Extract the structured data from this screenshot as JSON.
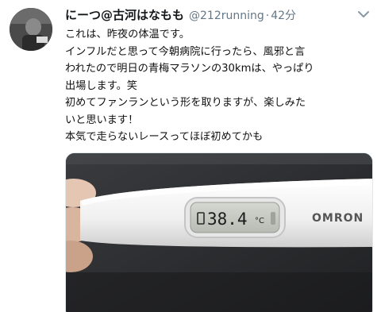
{
  "user": {
    "display_name": "にーつ@古河はなもも",
    "handle": "@212running",
    "separator": "·",
    "timestamp": "42分"
  },
  "icons": {
    "avatar": "avatar",
    "menu": "chevron-down-icon"
  },
  "tweet": {
    "lines": [
      "これは、昨夜の体温です。",
      "インフルだと思って今朝病院に行ったら、風邪と言",
      "われたので明日の青梅マラソンの30kmは、やっぱり",
      "出場します。笑",
      "初めてファンランという形を取りますが、楽しみた",
      "いと思います！",
      "本気で走らないレースってほぼ初めてかも"
    ]
  },
  "media": {
    "thermometer_reading": "38.4",
    "reading_unit": "°C",
    "brand": "OMRON"
  },
  "colors": {
    "text": "#14171a",
    "secondary": "#657786",
    "media_bg": "#2a2b2d",
    "thermometer_body": "#f2f2f2",
    "lcd": "#c9cdc6"
  }
}
